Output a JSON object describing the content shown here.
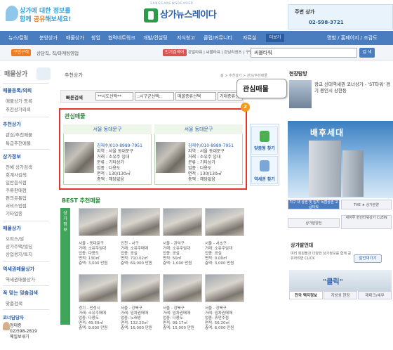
{
  "header": {
    "slogan_line1": "상가에 대한 정보를",
    "slogan_line2_pre": "함께 ",
    "slogan_line2_hl": "공유",
    "slogan_line2_post": "해보세요!",
    "logo_small": "SANGGANEWSREADER",
    "logo": "상가뉴스레이다",
    "phone_label": "주변 상가",
    "phone": "02-598-3721"
  },
  "nav": {
    "items": [
      "뉴스/칼럼",
      "분양상가",
      "매물상가",
      "창업",
      "협력네트워크",
      "개발/컨설팅",
      "지식창고",
      "클럽/커뮤니티",
      "자료실"
    ],
    "more": "더보기",
    "right": "명함 / 홈페이지 / 조감도"
  },
  "subnav": {
    "pill1": "구인구직",
    "text1": "상담직, 직/마케팅영업",
    "pill2": "인기검색어",
    "text2": "강일타워 | 씨블타워 | 강남리센츠 | 구인구직",
    "search_value": "씨블타워",
    "search_btn": "검 색"
  },
  "left": {
    "title": "매물상가",
    "sections": [
      {
        "title": "매물등록/의뢰",
        "items": [
          "매물상가 등록",
          "추천상가의뢰"
        ]
      },
      {
        "title": "추천상가",
        "items": [
          "관심/추천매물",
          "특급추천매물"
        ]
      },
      {
        "title": "상가정보",
        "items": [
          "전체 상가검색",
          "회계사검색",
          "일반음식점",
          "주류판매점",
          "편의유통업",
          "서비스업점",
          "기타업종"
        ]
      },
      {
        "title": "매물상가",
        "items": [
          "오피스/빌",
          "상가주택/빌딩",
          "상업용지/토지"
        ]
      },
      {
        "title": "역세권매물상가",
        "items": [
          "역세권매물상가"
        ]
      },
      {
        "title": "꼭 맞는 맞춤검색",
        "items": [
          "맞춤검색"
        ]
      }
    ],
    "coordinator_title": "코너담당자",
    "coordinator_name": "정태종",
    "coordinator_phone": "02)598-2819",
    "coordinator_msg": "메일보내기"
  },
  "center": {
    "breadcrumb_title": "추천상가",
    "breadcrumb_path": "홈 > 추천상가 > 관심/추천매물",
    "search_label": "빠른검색",
    "selects": [
      "**시도선택**",
      "::시구군선택::",
      "매물종류선택",
      "거래종류선택"
    ],
    "annotation": "관심매물",
    "annotation_num": "2",
    "hot_title": "관심매물",
    "hot_cards": [
      {
        "region": "서울 동대문구",
        "phone": "김재수/010-8989-7951",
        "lines": [
          "지역 : 서울 동대문구",
          "거래 : 소유주 임대",
          "분류 : 기타상가",
          "업종 : 다용도",
          "면적 : 130/130㎡",
          "층액 : 해당없음"
        ]
      },
      {
        "region": "서울 동대문구",
        "phone": "김재수/010-8989-7951",
        "lines": [
          "지역 : 서울 동대문구",
          "거래 : 소유주 임대",
          "분류 : 기타상가",
          "업종 : 다용도",
          "면적 : 130/130㎡",
          "층액 : 해당없음"
        ]
      }
    ],
    "find_btn1": "맞춤형 찾기",
    "find_btn2": "역세권 찾기",
    "best_title": "BEST 추천매물",
    "best_side": "상가정보",
    "best_items": [
      {
        "l1": "서울 - 동대문구",
        "l2": "거래: 소유주임대",
        "l3": "업종: 다용도",
        "l4": "면적: 130㎡",
        "l5": "층액: 3,000 만원"
      },
      {
        "l1": "인천 - 서구",
        "l2": "거래: 소유주매매",
        "l3": "업종: 공실",
        "l4": "면적: 710.02㎡",
        "l5": "층액: 69,000 만원"
      },
      {
        "l1": "서울 - 관악구",
        "l2": "거래: 소유주임대",
        "l3": "업종: 공실",
        "l4": "면적: 50㎡",
        "l5": "층액: 1,000 만원"
      },
      {
        "l1": "서울 - 서초구",
        "l2": "거래: 소유주임대",
        "l3": "업종: 공실",
        "l4": "면적: 0.00㎡",
        "l5": "층액: 3,000 만원"
      },
      {
        "l1": "경기 - 안성시",
        "l2": "거래: 소유주매매",
        "l3": "업종: 다용도",
        "l4": "면적: 49.59㎡",
        "l5": "층액: 9,000 만원"
      },
      {
        "l1": "서울 - 강북구",
        "l2": "거래: 임차권매매",
        "l3": "업종: 노래방",
        "l4": "면적: 132.23㎡",
        "l5": "층액: 16,000 만원"
      },
      {
        "l1": "서울 - 강북구",
        "l2": "거래: 임차권매매",
        "l3": "업종: 다용도",
        "l4": "면적: 99.17㎡",
        "l5": "층액: 15,000 만원"
      },
      {
        "l1": "서울 - 강북구",
        "l2": "거래: 임차권매매",
        "l3": "업종: 휴먼주점",
        "l4": "면적: 56.20㎡",
        "l5": "층액: 6,000 만원"
      }
    ]
  },
  "right": {
    "proj_title": "현장탐방",
    "proj_name": "광교 신대역세권 코너상가 - 'ST타워' 경기 용인시 상현동",
    "banner_title": "배후세대",
    "tabs": [
      "지구 내 상권 및 입지 독점상권 고급타워",
      "THE ★ 상가분양",
      "상가분양전",
      "새하루 현진타워상가 CLEIN"
    ],
    "card_title": "상가발언대",
    "card_text": "여러 회원들과 다양한 상가정보를 함께 공유하려면 CLICK",
    "card_btn": "발언대가기",
    "click_text": "\"클릭\"",
    "bottom_tabs": [
      "전국 택지정보",
      "지방성 현장",
      "재테크/세무"
    ]
  }
}
